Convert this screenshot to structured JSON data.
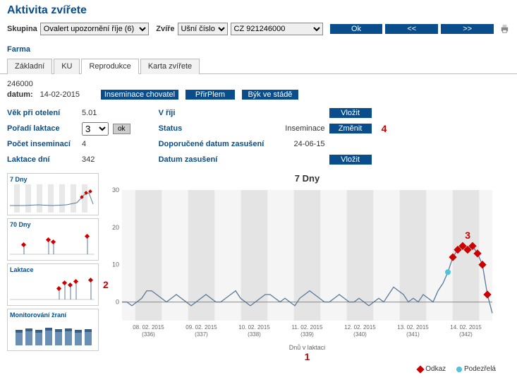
{
  "title": "Aktivita zvířete",
  "toolbar": {
    "group_label": "Skupina",
    "group_value": "Ovalert upozornění říje (6)",
    "animal_label": "Zvíře",
    "id_type": "Ušní číslo",
    "id_value": "CZ 921246000",
    "ok": "Ok",
    "prev": "<<",
    "next": ">>"
  },
  "farma": "Farma",
  "tabs": [
    "Základní",
    "KU",
    "Reprodukce",
    "Karta zvířete"
  ],
  "active_tab": 2,
  "animal_id": "246000",
  "date_label": "datum:",
  "date_value": "14-02-2015",
  "action_buttons": [
    "Inseminace chovatel",
    "PřirPlem",
    "Býk ve stádě"
  ],
  "left_info": [
    {
      "label": "Věk při otelení",
      "value": "5.01"
    },
    {
      "label": "Pořadí laktace",
      "value": "3",
      "select": true
    },
    {
      "label": "Počet inseminací",
      "value": "4"
    },
    {
      "label": "Laktace dní",
      "value": "342"
    }
  ],
  "ok_btn": "ok",
  "right_info": [
    {
      "label": "V říji",
      "value": "",
      "button": "Vložit"
    },
    {
      "label": "Status",
      "value": "Inseminace",
      "button": "Změnit",
      "annot": "4"
    },
    {
      "label": "Doporučené datum zasušení",
      "value": "24-06-15"
    },
    {
      "label": "Datum zasušení",
      "value": "",
      "button": "Vložit"
    }
  ],
  "thumbs": [
    "7 Dny",
    "70 Dny",
    "Laktace",
    "Monitorování žraní"
  ],
  "chart_title": "7 Dny",
  "x_axis_label": "Dnů v laktaci",
  "legend": {
    "odkaz": "Odkaz",
    "podezrela": "Podezřelá"
  },
  "annotations": {
    "a1": "1",
    "a2": "2",
    "a3": "3"
  },
  "chart_data": {
    "type": "line",
    "title": "7 Dny",
    "ylabel": "",
    "xlabel": "Dnů v laktaci",
    "ylim": [
      -5,
      30
    ],
    "x_ticks": [
      {
        "date": "08. 02. 2015",
        "lact": "(336)"
      },
      {
        "date": "09. 02. 2015",
        "lact": "(337)"
      },
      {
        "date": "10. 02. 2015",
        "lact": "(338)"
      },
      {
        "date": "11. 02. 2015",
        "lact": "(339)"
      },
      {
        "date": "12. 02. 2015",
        "lact": "(340)"
      },
      {
        "date": "13. 02. 2015",
        "lact": "(341)"
      },
      {
        "date": "14. 02. 2015",
        "lact": "(342)"
      }
    ],
    "series": [
      {
        "name": "activity",
        "color": "#5a7a9a",
        "values": [
          0,
          0,
          -1,
          0,
          1,
          3,
          3,
          2,
          1,
          0,
          1,
          2,
          1,
          0,
          -1,
          0,
          1,
          2,
          1,
          0,
          0,
          1,
          2,
          3,
          1,
          0,
          -1,
          0,
          1,
          2,
          2,
          1,
          0,
          1,
          0,
          -1,
          1,
          2,
          3,
          2,
          1,
          0,
          0,
          1,
          2,
          1,
          0,
          0,
          1,
          0,
          -1,
          0,
          1,
          0,
          2,
          4,
          3,
          2,
          0,
          1,
          0,
          2,
          1,
          0,
          3,
          5,
          8,
          12,
          14,
          15,
          14,
          15,
          13,
          10,
          2,
          -3
        ]
      }
    ],
    "markers_odkaz_x": [
      67,
      68,
      69,
      70,
      71,
      72,
      73,
      74
    ],
    "markers_podezrela_x": [
      66,
      67
    ]
  }
}
